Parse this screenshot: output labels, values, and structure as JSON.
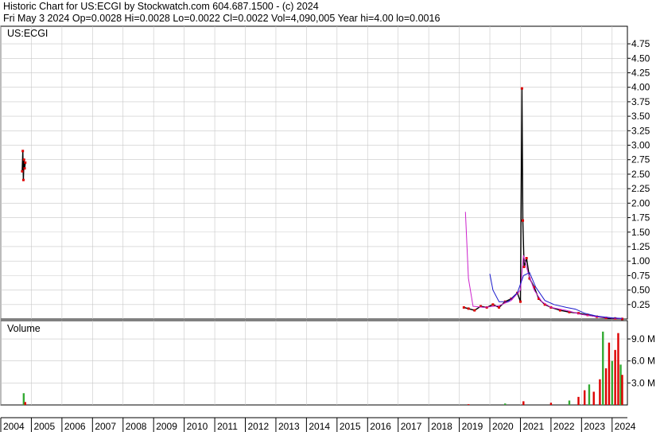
{
  "header": {
    "line1": "Historic Chart for US:ECGI by Stockwatch.com 604.687.1500 - (c) 2024",
    "line2": "Fri May  3 2024   Op=0.0028  Hi=0.0028  Lo=0.0022  Cl=0.0022   Vol=4,090,005   Year hi=4.00   lo=0.0016"
  },
  "chart_data": {
    "type": "line",
    "symbol_label": "US:ECGI",
    "price_axis": {
      "ylim": [
        0,
        4.75
      ],
      "ticks": [
        "0.25",
        "0.50",
        "0.75",
        "1.00",
        "1.25",
        "1.50",
        "1.75",
        "2.00",
        "2.25",
        "2.50",
        "2.75",
        "3.00",
        "3.25",
        "3.50",
        "3.75",
        "4.00",
        "4.25",
        "4.50",
        "4.75"
      ]
    },
    "volume_axis": {
      "title": "Volume",
      "ticks": [
        "3.0 M",
        "6.0 M",
        "9.0 M"
      ]
    },
    "x_axis": {
      "years": [
        "2004",
        "2005",
        "2006",
        "2007",
        "2008",
        "2009",
        "2010",
        "2011",
        "2012",
        "2013",
        "2014",
        "2015",
        "2016",
        "2017",
        "2018",
        "2019",
        "2020",
        "2021",
        "2022",
        "2023",
        "2024"
      ]
    },
    "colors": {
      "price": "#000000",
      "down": "#dd0000",
      "ma_short": "#cc22cc",
      "ma_long": "#1a1acc",
      "volume_up": "#33aa33",
      "volume_down": "#dd0000",
      "grid": "#c8c8c8"
    },
    "series": [
      {
        "values": [
          [
            2004.7,
            2.55
          ],
          [
            2004.72,
            2.9
          ],
          [
            2004.74,
            2.4
          ],
          [
            2004.76,
            2.75
          ],
          [
            2004.78,
            2.6
          ],
          [
            2004.8,
            2.7
          ],
          [
            2019.15,
            0.2
          ],
          [
            2019.3,
            0.18
          ],
          [
            2019.5,
            0.15
          ],
          [
            2019.7,
            0.22
          ],
          [
            2019.9,
            0.2
          ],
          [
            2020.1,
            0.25
          ],
          [
            2020.3,
            0.2
          ],
          [
            2020.5,
            0.3
          ],
          [
            2020.7,
            0.35
          ],
          [
            2020.9,
            0.45
          ],
          [
            2021.0,
            0.3
          ],
          [
            2021.05,
            3.98
          ],
          [
            2021.08,
            1.7
          ],
          [
            2021.12,
            0.9
          ],
          [
            2021.2,
            1.05
          ],
          [
            2021.3,
            0.7
          ],
          [
            2021.45,
            0.55
          ],
          [
            2021.6,
            0.35
          ],
          [
            2021.8,
            0.25
          ],
          [
            2022.0,
            0.2
          ],
          [
            2022.3,
            0.15
          ],
          [
            2022.6,
            0.12
          ],
          [
            2022.9,
            0.1
          ],
          [
            2023.2,
            0.07
          ],
          [
            2023.5,
            0.04
          ],
          [
            2023.8,
            0.02
          ],
          [
            2024.1,
            0.01
          ],
          [
            2024.33,
            0.0022
          ]
        ]
      },
      {
        "values": [
          [
            2019.2,
            1.85
          ],
          [
            2019.3,
            0.7
          ],
          [
            2019.45,
            0.22
          ],
          [
            2019.8,
            0.2
          ],
          [
            2020.3,
            0.23
          ],
          [
            2020.7,
            0.32
          ],
          [
            2021.0,
            0.5
          ],
          [
            2021.1,
            1.1
          ],
          [
            2021.25,
            0.8
          ],
          [
            2021.45,
            0.5
          ],
          [
            2021.7,
            0.3
          ],
          [
            2022.0,
            0.2
          ],
          [
            2022.5,
            0.15
          ],
          [
            2023.0,
            0.08
          ],
          [
            2023.5,
            0.04
          ],
          [
            2024.0,
            0.015
          ],
          [
            2024.33,
            0.005
          ]
        ]
      },
      {
        "values": [
          [
            2020.0,
            0.78
          ],
          [
            2020.1,
            0.5
          ],
          [
            2020.3,
            0.3
          ],
          [
            2020.6,
            0.3
          ],
          [
            2020.9,
            0.45
          ],
          [
            2021.1,
            0.75
          ],
          [
            2021.3,
            0.8
          ],
          [
            2021.5,
            0.55
          ],
          [
            2021.8,
            0.32
          ],
          [
            2022.1,
            0.25
          ],
          [
            2022.5,
            0.2
          ],
          [
            2022.8,
            0.17
          ],
          [
            2023.1,
            0.1
          ],
          [
            2023.5,
            0.05
          ],
          [
            2024.0,
            0.02
          ],
          [
            2024.33,
            0.01
          ]
        ]
      }
    ],
    "volume_millions": [
      [
        2004.75,
        1.6
      ],
      [
        2004.8,
        0.4
      ],
      [
        2019.3,
        0.1
      ],
      [
        2020.5,
        0.2
      ],
      [
        2021.1,
        0.5
      ],
      [
        2022.0,
        0.3
      ],
      [
        2022.6,
        0.6
      ],
      [
        2022.9,
        1.1
      ],
      [
        2023.1,
        2.0
      ],
      [
        2023.25,
        2.8
      ],
      [
        2023.4,
        1.8
      ],
      [
        2023.6,
        3.5
      ],
      [
        2023.7,
        10.0
      ],
      [
        2023.8,
        5.0
      ],
      [
        2023.9,
        8.5
      ],
      [
        2024.0,
        6.0
      ],
      [
        2024.1,
        7.5
      ],
      [
        2024.2,
        9.8
      ],
      [
        2024.28,
        5.5
      ],
      [
        2024.33,
        4.1
      ]
    ]
  }
}
